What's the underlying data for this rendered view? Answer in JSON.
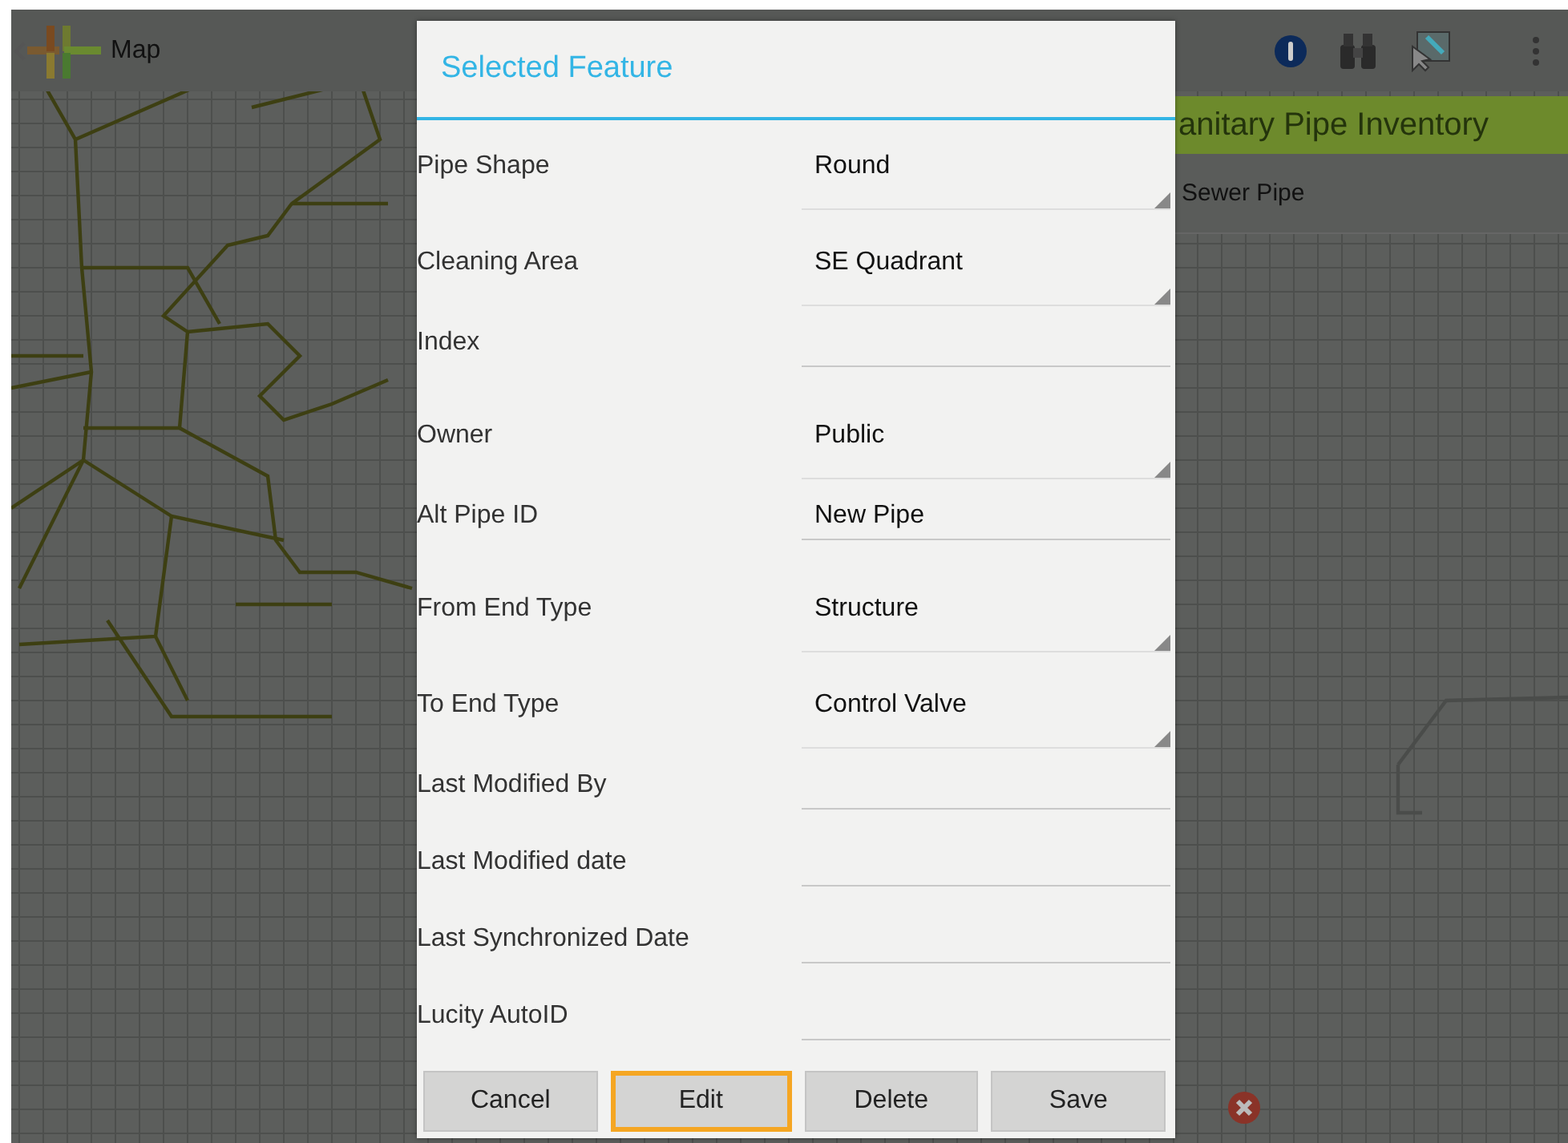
{
  "app_bar": {
    "title": "Map"
  },
  "side_panel": {
    "header": "anitary Pipe Inventory",
    "item": "Sewer Pipe"
  },
  "dialog": {
    "title": "Selected Feature",
    "fields": [
      {
        "label": "Pipe Shape",
        "kind": "dropdown",
        "value": "Round"
      },
      {
        "label": "Cleaning Area",
        "kind": "dropdown",
        "value": "SE Quadrant"
      },
      {
        "label": "Index",
        "kind": "text"
      },
      {
        "label": "Owner",
        "kind": "dropdown",
        "value": "Public"
      },
      {
        "label": "Alt Pipe ID",
        "kind": "text",
        "value": "New Pipe"
      },
      {
        "label": "From End Type",
        "kind": "dropdown",
        "value": "Structure"
      },
      {
        "label": "To End Type",
        "kind": "dropdown",
        "value": "Control Valve"
      },
      {
        "label": "Last Modified By",
        "kind": "text"
      },
      {
        "label": "Last Modified date",
        "kind": "text"
      },
      {
        "label": "Last Synchronized Date",
        "kind": "text"
      },
      {
        "label": "Lucity AutoID",
        "kind": "text"
      }
    ],
    "buttons": [
      {
        "label": "Cancel",
        "focused": false
      },
      {
        "label": "Edit",
        "focused": true
      },
      {
        "label": "Delete",
        "focused": false
      },
      {
        "label": "Save",
        "focused": false
      }
    ]
  }
}
